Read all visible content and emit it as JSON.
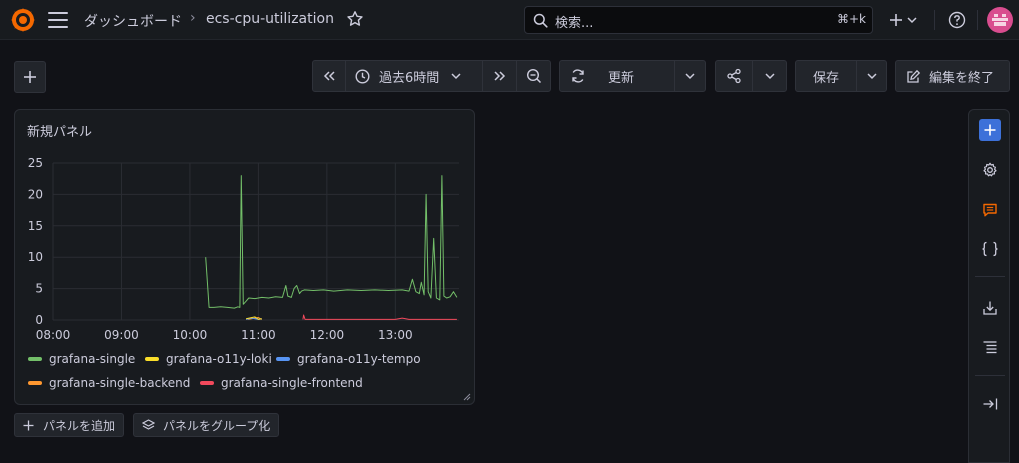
{
  "topbar": {
    "breadcrumb": [
      "ダッシュボード",
      "ecs-cpu-utilization"
    ],
    "search_placeholder": "検索...",
    "search_shortcut": "⌘+k",
    "brand_color": "#f46800"
  },
  "toolbar": {
    "time_range": "過去6時間",
    "refresh_label": "更新",
    "save_label": "保存",
    "exit_edit_label": "編集を終了"
  },
  "panel": {
    "title": "新規パネル"
  },
  "chart_data": {
    "type": "line",
    "title": "新規パネル",
    "y_ticks": [
      "0",
      "5",
      "10",
      "15",
      "20",
      "25"
    ],
    "x_ticks": [
      "08:00",
      "09:00",
      "10:00",
      "11:00",
      "12:00",
      "13:00"
    ],
    "ylim": [
      0,
      25
    ],
    "xlim_hours": [
      8.0,
      13.93
    ],
    "grid": true,
    "legend_position": "bottom",
    "series": [
      {
        "name": "grafana-single",
        "color": "#73bf69",
        "points": [
          [
            10.23,
            10.0
          ],
          [
            10.28,
            2.0
          ],
          [
            10.35,
            2.0
          ],
          [
            10.45,
            2.1
          ],
          [
            10.55,
            2.0
          ],
          [
            10.65,
            1.9
          ],
          [
            10.7,
            2.1
          ],
          [
            10.73,
            2.0
          ],
          [
            10.75,
            23.0
          ],
          [
            10.78,
            2.5
          ],
          [
            10.82,
            3.0
          ],
          [
            10.86,
            3.5
          ],
          [
            10.95,
            3.4
          ],
          [
            11.05,
            3.6
          ],
          [
            11.15,
            3.5
          ],
          [
            11.25,
            3.7
          ],
          [
            11.35,
            3.6
          ],
          [
            11.4,
            5.5
          ],
          [
            11.43,
            3.8
          ],
          [
            11.48,
            3.6
          ],
          [
            11.52,
            5.0
          ],
          [
            11.56,
            5.5
          ],
          [
            11.6,
            4.2
          ],
          [
            11.63,
            4.6
          ],
          [
            11.67,
            4.8
          ],
          [
            11.8,
            4.7
          ],
          [
            11.95,
            4.8
          ],
          [
            12.1,
            4.6
          ],
          [
            12.3,
            4.8
          ],
          [
            12.5,
            4.7
          ],
          [
            12.7,
            4.8
          ],
          [
            12.9,
            4.7
          ],
          [
            13.1,
            4.8
          ],
          [
            13.2,
            4.6
          ],
          [
            13.25,
            6.5
          ],
          [
            13.3,
            4.5
          ],
          [
            13.35,
            4.2
          ],
          [
            13.38,
            6.0
          ],
          [
            13.42,
            4.0
          ],
          [
            13.45,
            20.0
          ],
          [
            13.48,
            4.5
          ],
          [
            13.52,
            3.5
          ],
          [
            13.56,
            13.0
          ],
          [
            13.6,
            3.5
          ],
          [
            13.65,
            3.2
          ],
          [
            13.68,
            23.0
          ],
          [
            13.71,
            3.8
          ],
          [
            13.75,
            3.5
          ],
          [
            13.8,
            3.7
          ],
          [
            13.85,
            4.5
          ],
          [
            13.9,
            3.6
          ]
        ]
      },
      {
        "name": "grafana-o11y-loki",
        "color": "#fade2a",
        "points": [
          [
            10.82,
            0.2
          ],
          [
            10.95,
            0.5
          ],
          [
            11.0,
            0.1
          ],
          [
            11.05,
            0.2
          ]
        ]
      },
      {
        "name": "grafana-o11y-tempo",
        "color": "#5794f2",
        "points": [
          [
            10.82,
            0.1
          ],
          [
            10.9,
            0.3
          ],
          [
            11.0,
            0.1
          ],
          [
            11.05,
            0.2
          ]
        ]
      },
      {
        "name": "grafana-single-backend",
        "color": "#ff9830",
        "points": [
          [
            10.85,
            0.1
          ],
          [
            11.0,
            0.4
          ],
          [
            11.05,
            0.1
          ]
        ]
      },
      {
        "name": "grafana-single-frontend",
        "color": "#f2495c",
        "points": [
          [
            11.65,
            0.1
          ],
          [
            11.66,
            0.8
          ],
          [
            11.68,
            0.1
          ],
          [
            12.0,
            0.1
          ],
          [
            12.5,
            0.1
          ],
          [
            13.0,
            0.1
          ],
          [
            13.1,
            0.3
          ],
          [
            13.2,
            0.1
          ],
          [
            13.9,
            0.1
          ]
        ]
      }
    ]
  },
  "bottom_buttons": {
    "add_panel": "パネルを追加",
    "group_panel": "パネルをグループ化"
  }
}
